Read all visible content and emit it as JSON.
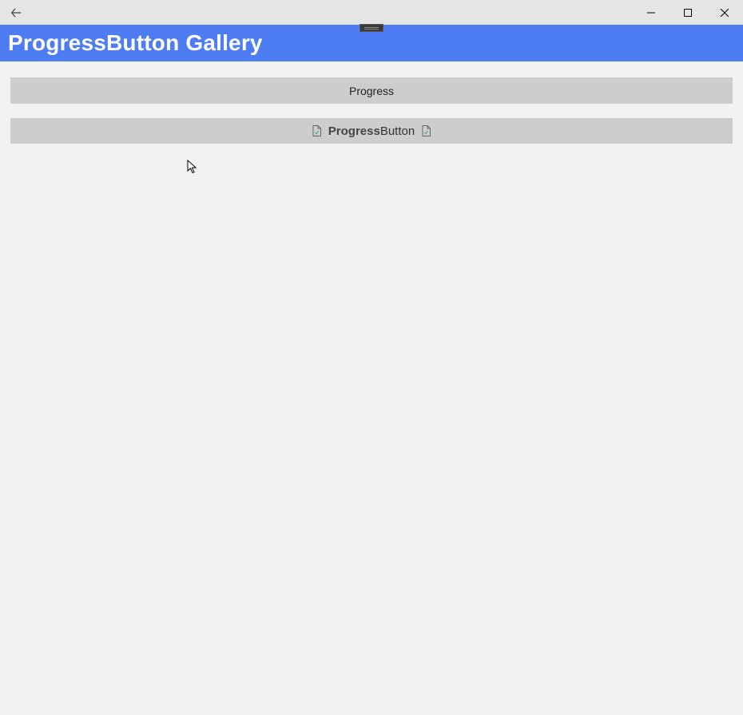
{
  "titlebar": {
    "back_icon": "back-arrow",
    "minimize_icon": "minimize",
    "maximize_icon": "maximize",
    "close_icon": "close"
  },
  "header": {
    "title": "ProgressButton Gallery"
  },
  "buttons": {
    "button1": {
      "label": "Progress"
    },
    "button2": {
      "label_bold": "Progress",
      "label_normal": "Button",
      "left_icon": "document-icon",
      "right_icon": "document-icon"
    }
  }
}
